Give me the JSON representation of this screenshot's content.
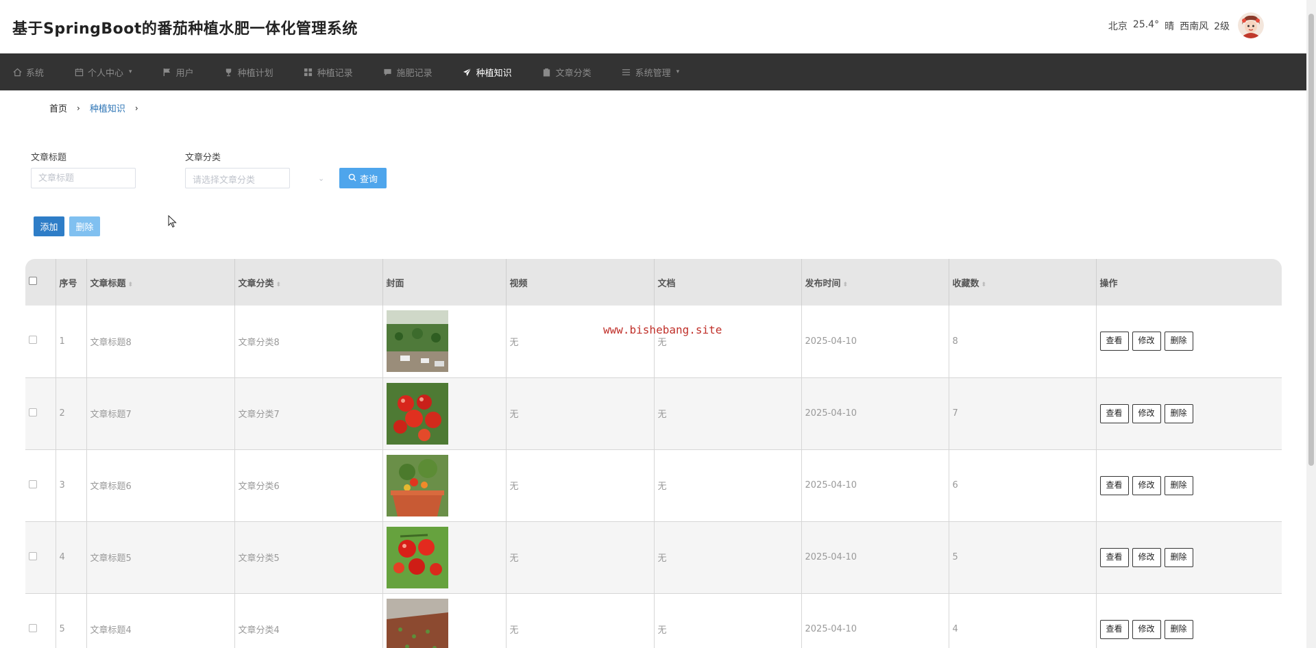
{
  "header": {
    "title": "基于SpringBoot的番茄种植水肥一体化管理系统",
    "weather": {
      "city": "北京",
      "temp": "25.4°",
      "condition": "晴",
      "wind": "西南风",
      "level": "2级"
    }
  },
  "nav": {
    "items": [
      {
        "label": "系统",
        "icon": "home-icon"
      },
      {
        "label": "个人中心",
        "icon": "calendar-icon",
        "dropdown": true
      },
      {
        "label": "用户",
        "icon": "flag-icon"
      },
      {
        "label": "种植计划",
        "icon": "trophy-icon"
      },
      {
        "label": "种植记录",
        "icon": "grid-icon"
      },
      {
        "label": "施肥记录",
        "icon": "comment-icon"
      },
      {
        "label": "种植知识",
        "icon": "paper-plane-icon",
        "active": true
      },
      {
        "label": "文章分类",
        "icon": "clipboard-icon"
      },
      {
        "label": "系统管理",
        "icon": "list-icon",
        "dropdown": true
      }
    ]
  },
  "breadcrumb": {
    "home": "首页",
    "current": "种植知识"
  },
  "search": {
    "title_label": "文章标题",
    "title_placeholder": "文章标题",
    "category_label": "文章分类",
    "category_placeholder": "请选择文章分类",
    "query_label": "查询"
  },
  "actions": {
    "add_label": "添加",
    "delete_label": "删除"
  },
  "table": {
    "columns": {
      "index": "序号",
      "title": "文章标题",
      "category": "文章分类",
      "cover": "封面",
      "video": "视频",
      "doc": "文档",
      "publish_time": "发布时间",
      "favorites": "收藏数",
      "ops": "操作"
    },
    "op_labels": {
      "view": "查看",
      "edit": "修改",
      "delete": "删除"
    },
    "rows": [
      {
        "index": "1",
        "title": "文章标题8",
        "category": "文章分类8",
        "video": "无",
        "doc": "无",
        "publish_time": "2025-04-10",
        "favorites": "8"
      },
      {
        "index": "2",
        "title": "文章标题7",
        "category": "文章分类7",
        "video": "无",
        "doc": "无",
        "publish_time": "2025-04-10",
        "favorites": "7"
      },
      {
        "index": "3",
        "title": "文章标题6",
        "category": "文章分类6",
        "video": "无",
        "doc": "无",
        "publish_time": "2025-04-10",
        "favorites": "6"
      },
      {
        "index": "4",
        "title": "文章标题5",
        "category": "文章分类5",
        "video": "无",
        "doc": "无",
        "publish_time": "2025-04-10",
        "favorites": "5"
      },
      {
        "index": "5",
        "title": "文章标题4",
        "category": "文章分类4",
        "video": "无",
        "doc": "无",
        "publish_time": "2025-04-10",
        "favorites": "4"
      }
    ]
  },
  "watermark": "www.bishebang.site"
}
